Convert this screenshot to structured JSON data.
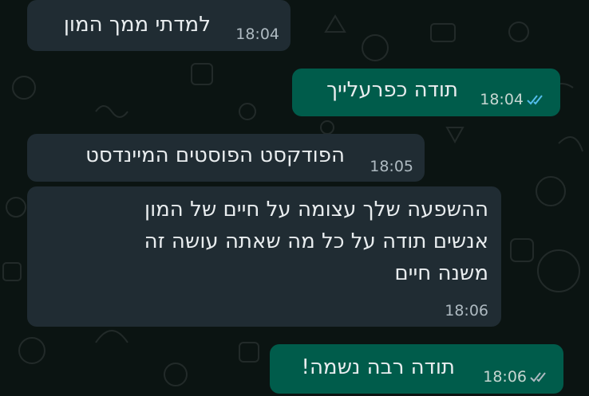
{
  "theme": {
    "chat_background": "#0b1412",
    "incoming_bubble": "#202c33",
    "outgoing_bubble": "#005c4b",
    "read_tick": "#53bdeb",
    "delivered_tick": "#aebac1"
  },
  "messages": [
    {
      "direction": "incoming",
      "text": "למדתי ממך המון",
      "time": "18:04"
    },
    {
      "direction": "outgoing",
      "text": "תודה כפרעלייך",
      "time": "18:04",
      "status": "read",
      "status_icon": "double-check-read-icon"
    },
    {
      "direction": "incoming",
      "text": "הפודקסט הפוסטים המיינדסט",
      "time": "18:05"
    },
    {
      "direction": "incoming",
      "lines": [
        "ההשפעה שלך עצומה על חיים של המון",
        "אנשים תודה על כל מה שאתה עושה זה",
        "משנה חיים"
      ],
      "time": "18:06"
    },
    {
      "direction": "outgoing",
      "text": "תודה רבה נשמה!",
      "time": "18:06",
      "status": "delivered",
      "status_icon": "double-check-delivered-icon"
    }
  ]
}
